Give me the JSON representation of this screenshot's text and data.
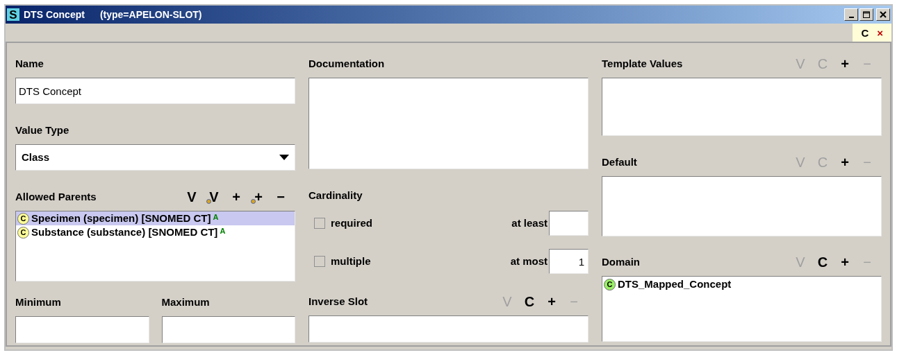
{
  "window": {
    "icon_letter": "S",
    "title": "DTS Concept",
    "subtitle": "(type=APELON-SLOT)"
  },
  "corner_buttons": [
    {
      "label": "C",
      "kind": "plain"
    },
    {
      "label": "×",
      "kind": "close"
    }
  ],
  "name": {
    "label": "Name",
    "value": "DTS Concept"
  },
  "value_type": {
    "label": "Value Type",
    "value": "Class"
  },
  "allowed_parents": {
    "label": "Allowed Parents",
    "actions": [
      {
        "label": "V",
        "kind": "plain",
        "disabled": false
      },
      {
        "label": "V",
        "kind": "extended",
        "disabled": false
      },
      {
        "label": "+",
        "kind": "plain",
        "disabled": false
      },
      {
        "label": "+",
        "kind": "extended",
        "disabled": false
      },
      {
        "label": "−",
        "kind": "plain",
        "disabled": false
      }
    ],
    "items": [
      {
        "badge": "C",
        "color": "#ffff99",
        "text": "Specimen (specimen) [SNOMED CT]",
        "flag": "A",
        "selected": true
      },
      {
        "badge": "C",
        "color": "#ffff99",
        "text": "Substance (substance) [SNOMED CT]",
        "flag": "A",
        "selected": false
      }
    ]
  },
  "minimum": {
    "label": "Minimum"
  },
  "maximum": {
    "label": "Maximum"
  },
  "documentation": {
    "label": "Documentation"
  },
  "cardinality": {
    "label": "Cardinality",
    "rows": [
      {
        "label": "required",
        "checked": false,
        "bound_label": "at least"
      },
      {
        "label": "multiple",
        "checked": false,
        "bound_label": "at most",
        "bound_value": "1"
      }
    ]
  },
  "inverse_slot": {
    "label": "Inverse Slot",
    "actions": [
      {
        "label": "V",
        "disabled": true
      },
      {
        "label": "C",
        "disabled": false
      },
      {
        "label": "+",
        "disabled": false
      },
      {
        "label": "−",
        "disabled": true
      }
    ]
  },
  "template_values": {
    "label": "Template Values",
    "actions": [
      {
        "label": "V",
        "disabled": true
      },
      {
        "label": "C",
        "disabled": true
      },
      {
        "label": "+",
        "disabled": false
      },
      {
        "label": "−",
        "disabled": true
      }
    ]
  },
  "default": {
    "label": "Default",
    "actions": [
      {
        "label": "V",
        "disabled": true
      },
      {
        "label": "C",
        "disabled": true
      },
      {
        "label": "+",
        "disabled": false
      },
      {
        "label": "−",
        "disabled": true
      }
    ]
  },
  "domain": {
    "label": "Domain",
    "actions": [
      {
        "label": "V",
        "disabled": true
      },
      {
        "label": "C",
        "disabled": false
      },
      {
        "label": "+",
        "disabled": false
      },
      {
        "label": "−",
        "disabled": true
      }
    ],
    "items": [
      {
        "badge": "C",
        "color": "#99ee66",
        "text": "DTS_Mapped_Concept"
      }
    ]
  }
}
